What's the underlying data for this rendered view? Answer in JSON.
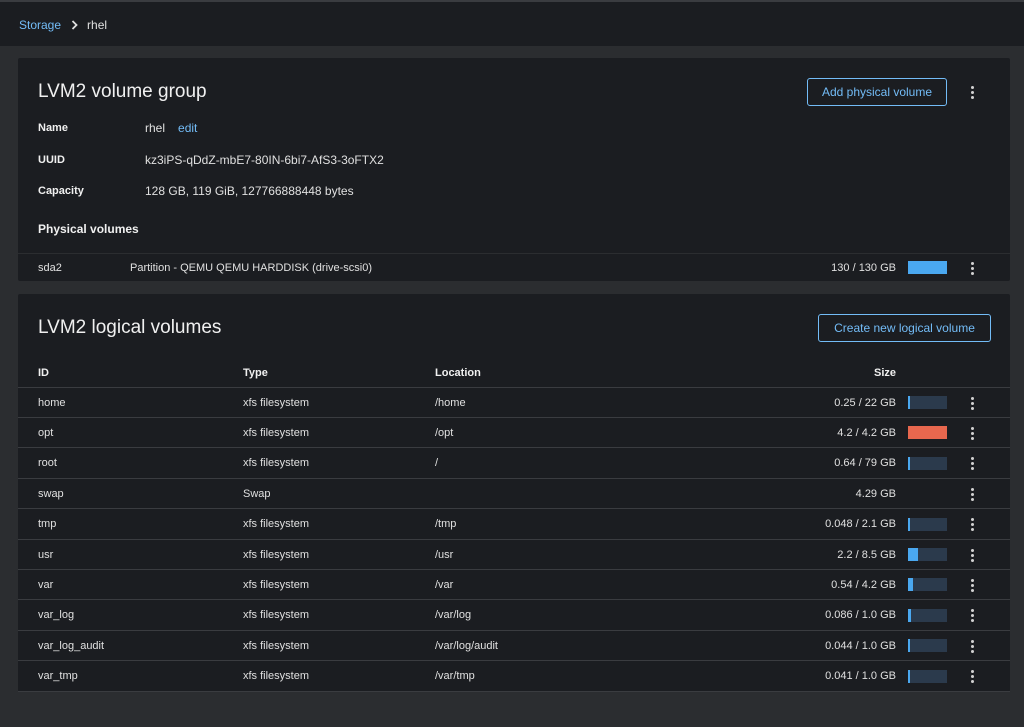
{
  "breadcrumb": {
    "root": "Storage",
    "current": "rhel"
  },
  "volume_group": {
    "title": "LVM2 volume group",
    "add_button": "Add physical volume",
    "fields": {
      "name_label": "Name",
      "name_value": "rhel",
      "edit_label": "edit",
      "uuid_label": "UUID",
      "uuid_value": "kz3iPS-qDdZ-mbE7-80IN-6bi7-AfS3-3oFTX2",
      "capacity_label": "Capacity",
      "capacity_value": "128 GB, 119 GiB, 127766888448 bytes"
    },
    "physical_volumes_label": "Physical volumes",
    "physical_volumes": [
      {
        "id": "sda2",
        "description": "Partition - QEMU QEMU HARDDISK (drive-scsi0)",
        "size": "130 / 130 GB",
        "fill": 1.0
      }
    ]
  },
  "logical_volumes": {
    "title": "LVM2 logical volumes",
    "create_button": "Create new logical volume",
    "columns": {
      "id": "ID",
      "type": "Type",
      "location": "Location",
      "size": "Size"
    },
    "rows": [
      {
        "id": "home",
        "type": "xfs filesystem",
        "location": "/home",
        "size": "0.25 / 22 GB",
        "fill": 0.011,
        "bar": true,
        "over": false
      },
      {
        "id": "opt",
        "type": "xfs filesystem",
        "location": "/opt",
        "size": "4.2 / 4.2 GB",
        "fill": 1.0,
        "bar": true,
        "over": true
      },
      {
        "id": "root",
        "type": "xfs filesystem",
        "location": "/",
        "size": "0.64 / 79 GB",
        "fill": 0.008,
        "bar": true,
        "over": false
      },
      {
        "id": "swap",
        "type": "Swap",
        "location": "",
        "size": "4.29 GB",
        "fill": 0,
        "bar": false,
        "over": false
      },
      {
        "id": "tmp",
        "type": "xfs filesystem",
        "location": "/tmp",
        "size": "0.048 / 2.1 GB",
        "fill": 0.023,
        "bar": true,
        "over": false
      },
      {
        "id": "usr",
        "type": "xfs filesystem",
        "location": "/usr",
        "size": "2.2 / 8.5 GB",
        "fill": 0.26,
        "bar": true,
        "over": false
      },
      {
        "id": "var",
        "type": "xfs filesystem",
        "location": "/var",
        "size": "0.54 / 4.2 GB",
        "fill": 0.13,
        "bar": true,
        "over": false
      },
      {
        "id": "var_log",
        "type": "xfs filesystem",
        "location": "/var/log",
        "size": "0.086 / 1.0 GB",
        "fill": 0.086,
        "bar": true,
        "over": false
      },
      {
        "id": "var_log_audit",
        "type": "xfs filesystem",
        "location": "/var/log/audit",
        "size": "0.044 / 1.0 GB",
        "fill": 0.044,
        "bar": true,
        "over": false
      },
      {
        "id": "var_tmp",
        "type": "xfs filesystem",
        "location": "/var/tmp",
        "size": "0.041 / 1.0 GB",
        "fill": 0.041,
        "bar": true,
        "over": false
      }
    ]
  },
  "colors": {
    "accent": "#73bcf7",
    "bar_fill": "#4aa8f0",
    "bar_over": "#e8674e",
    "bar_track": "#2b3a4c"
  }
}
